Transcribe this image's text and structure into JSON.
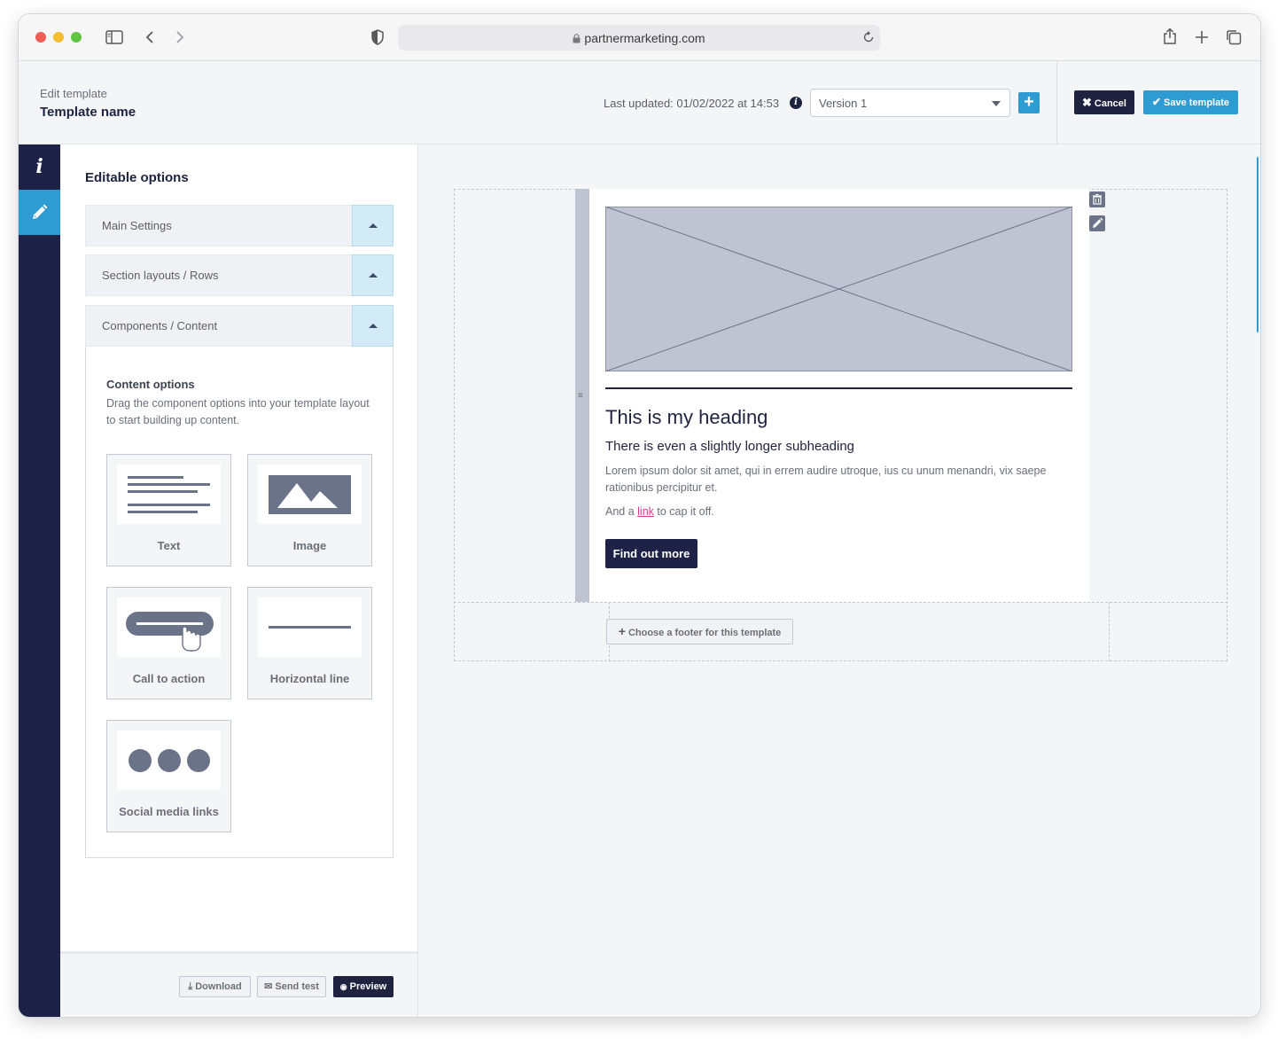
{
  "browser": {
    "url": "partnermarketing.com"
  },
  "header": {
    "subtitle": "Edit template",
    "title": "Template name",
    "last_updated": "Last updated: 01/02/2022 at 14:53",
    "version_selected": "Version 1",
    "cancel_label": "Cancel",
    "save_label": "Save template"
  },
  "rail": {
    "info_glyph": "i"
  },
  "panel": {
    "title": "Editable options",
    "accordions": [
      {
        "label": "Main Settings"
      },
      {
        "label": "Section layouts / Rows"
      },
      {
        "label": "Components / Content"
      }
    ],
    "content": {
      "title": "Content options",
      "description": "Drag the component options into your template layout to start building up content.",
      "tiles": [
        {
          "label": "Text",
          "icon": "text-lines-icon"
        },
        {
          "label": "Image",
          "icon": "image-mountains-icon"
        },
        {
          "label": "Call to action",
          "icon": "button-cursor-icon"
        },
        {
          "label": "Horizontal line",
          "icon": "horizontal-line-icon"
        },
        {
          "label": "Social media links",
          "icon": "social-dots-icon"
        }
      ]
    },
    "footer": {
      "download_label": "Download",
      "send_test_label": "Send test",
      "preview_label": "Preview"
    }
  },
  "email": {
    "heading": "This is my heading",
    "subheading": "There is even a slightly longer subheading",
    "body": "Lorem ipsum dolor sit amet, qui in errem audire utroque, ius cu unum menandri, vix saepe rationibus percipitur et.",
    "link_prefix": "And a ",
    "link_text": "link",
    "link_suffix": " to cap it off.",
    "cta_label": "Find out more",
    "footer_button_label": "Choose a footer for this template"
  },
  "colors": {
    "navy": "#1f2247",
    "accent_blue": "#2f9bd3",
    "link_pink": "#d63a8f",
    "placeholder_grey": "#c0c4d2"
  }
}
